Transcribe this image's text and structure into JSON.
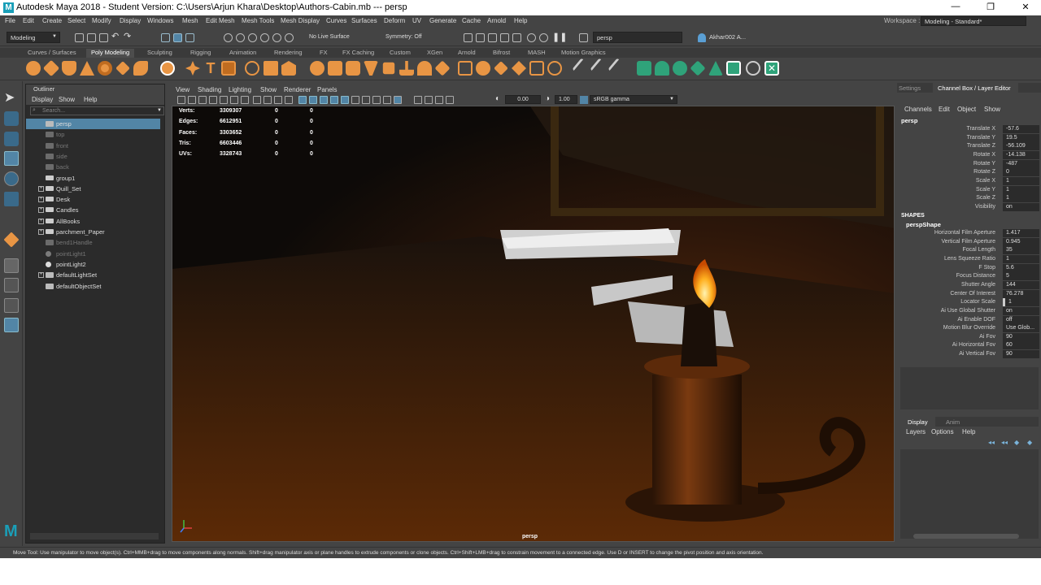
{
  "titlebar": {
    "title": "Autodesk Maya 2018 - Student Version: C:\\Users\\Arjun Khara\\Desktop\\Authors-Cabin.mb   ---   persp",
    "minimize": "—",
    "maximize": "❐",
    "close": "✕"
  },
  "menus": [
    "File",
    "Edit",
    "Create",
    "Select",
    "Modify",
    "Display",
    "Windows",
    "Mesh",
    "Edit Mesh",
    "Mesh Tools",
    "Mesh Display",
    "Curves",
    "Surfaces",
    "Deform",
    "UV",
    "Generate",
    "Cache",
    "Arnold",
    "Help"
  ],
  "workspace": {
    "label": "Workspace :",
    "value": "Modeling - Standard*"
  },
  "status": {
    "menuset": "Modeling",
    "live_surface": "No Live Surface",
    "symmetry": "Symmetry: Off",
    "camera_field": "persp",
    "user": "Akhar002 A..."
  },
  "shelf_tabs": [
    "Curves / Surfaces",
    "Poly Modeling",
    "Sculpting",
    "Rigging",
    "Animation",
    "Rendering",
    "FX",
    "FX Caching",
    "Custom",
    "XGen",
    "Arnold",
    "Bifrost",
    "MASH",
    "Motion Graphics"
  ],
  "active_shelf": "Poly Modeling",
  "outliner": {
    "title": "Outliner",
    "menu": [
      "Display",
      "Show",
      "Help"
    ],
    "search_placeholder": "Search...",
    "items": [
      {
        "label": "persp",
        "selected": true,
        "dim": false,
        "expand": false,
        "icon": "camera-icon"
      },
      {
        "label": "top",
        "selected": false,
        "dim": true,
        "expand": false,
        "icon": "camera-icon"
      },
      {
        "label": "front",
        "selected": false,
        "dim": true,
        "expand": false,
        "icon": "camera-icon"
      },
      {
        "label": "side",
        "selected": false,
        "dim": true,
        "expand": false,
        "icon": "camera-icon"
      },
      {
        "label": "back",
        "selected": false,
        "dim": true,
        "expand": false,
        "icon": "camera-icon"
      },
      {
        "label": "group1",
        "selected": false,
        "dim": false,
        "expand": false,
        "icon": "group-icon"
      },
      {
        "label": "Quill_Set",
        "selected": false,
        "dim": false,
        "expand": true,
        "icon": "group-icon"
      },
      {
        "label": "Desk",
        "selected": false,
        "dim": false,
        "expand": true,
        "icon": "group-icon"
      },
      {
        "label": "Candles",
        "selected": false,
        "dim": false,
        "expand": true,
        "icon": "group-icon"
      },
      {
        "label": "AllBooks",
        "selected": false,
        "dim": false,
        "expand": true,
        "icon": "group-icon"
      },
      {
        "label": "parchment_Paper",
        "selected": false,
        "dim": false,
        "expand": true,
        "icon": "group-icon"
      },
      {
        "label": "bend1Handle",
        "selected": false,
        "dim": true,
        "expand": false,
        "icon": "deformer-icon"
      },
      {
        "label": "pointLight1",
        "selected": false,
        "dim": true,
        "expand": false,
        "icon": "light-icon"
      },
      {
        "label": "pointLight2",
        "selected": false,
        "dim": false,
        "expand": false,
        "icon": "light-icon"
      },
      {
        "label": "defaultLightSet",
        "selected": false,
        "dim": false,
        "expand": true,
        "icon": "set-icon"
      },
      {
        "label": "defaultObjectSet",
        "selected": false,
        "dim": false,
        "expand": false,
        "icon": "set-icon"
      }
    ]
  },
  "viewport": {
    "menu": [
      "View",
      "Shading",
      "Lighting",
      "Show",
      "Renderer",
      "Panels"
    ],
    "exposure": "0.00",
    "gamma": "1.00",
    "color_space": "sRGB gamma",
    "camera_label": "persp",
    "hud": [
      {
        "label": "Verts:",
        "total": "3309307",
        "sel": "0",
        "comp": "0"
      },
      {
        "label": "Edges:",
        "total": "6612951",
        "sel": "0",
        "comp": "0"
      },
      {
        "label": "Faces:",
        "total": "3303652",
        "sel": "0",
        "comp": "0"
      },
      {
        "label": "Tris:",
        "total": "6603446",
        "sel": "0",
        "comp": "0"
      },
      {
        "label": "UVs:",
        "total": "3328743",
        "sel": "0",
        "comp": "0"
      }
    ]
  },
  "channel_box": {
    "tabs": [
      "Settings",
      "Channel Box / Layer Editor"
    ],
    "menu": [
      "Channels",
      "Edit",
      "Object",
      "Show"
    ],
    "object": "persp",
    "attrs": [
      {
        "n": "Translate X",
        "v": "-57.6"
      },
      {
        "n": "Translate Y",
        "v": "19.5"
      },
      {
        "n": "Translate Z",
        "v": "-56.109"
      },
      {
        "n": "Rotate X",
        "v": "-14.138"
      },
      {
        "n": "Rotate Y",
        "v": "-487"
      },
      {
        "n": "Rotate Z",
        "v": "0"
      },
      {
        "n": "Scale X",
        "v": "1"
      },
      {
        "n": "Scale Y",
        "v": "1"
      },
      {
        "n": "Scale Z",
        "v": "1"
      },
      {
        "n": "Visibility",
        "v": "on"
      }
    ],
    "shapes_header": "SHAPES",
    "shape_name": "perspShape",
    "shape_attrs": [
      {
        "n": "Horizontal Film Aperture",
        "v": "1.417"
      },
      {
        "n": "Vertical Film Aperture",
        "v": "0.945"
      },
      {
        "n": "Focal Length",
        "v": "35"
      },
      {
        "n": "Lens Squeeze Ratio",
        "v": "1"
      },
      {
        "n": "F Stop",
        "v": "5.6"
      },
      {
        "n": "Focus Distance",
        "v": "5"
      },
      {
        "n": "Shutter Angle",
        "v": "144"
      },
      {
        "n": "Center Of Interest",
        "v": "76.278"
      },
      {
        "n": "Locator Scale",
        "v": "1"
      },
      {
        "n": "Ai Use Global Shutter",
        "v": "on"
      },
      {
        "n": "Ai Enable DOF",
        "v": "off"
      },
      {
        "n": "Motion Blur Override",
        "v": "Use Glob..."
      },
      {
        "n": "Ai Fov",
        "v": "90"
      },
      {
        "n": "Ai Horizontal Fov",
        "v": "60"
      },
      {
        "n": "Ai Vertical Fov",
        "v": "90"
      }
    ]
  },
  "layer_editor": {
    "tabs": [
      "Display",
      "Anim"
    ],
    "menu": [
      "Layers",
      "Options",
      "Help"
    ]
  },
  "help_line": "Move Tool: Use manipulator to move object(s). Ctrl+MMB+drag to move components along normals. Shift+drag manipulator axis or plane handles to extrude components or clone objects. Ctrl+Shift+LMB+drag to constrain movement to a connected edge. Use D or INSERT to change the pivot position and axis orientation.",
  "colors": {
    "selection": "#5285a6",
    "maya_blue": "#1a9fb8",
    "shelf_orange": "#e89544",
    "shelf_green": "#2fa37a",
    "candle_glow": "#c8601a"
  }
}
